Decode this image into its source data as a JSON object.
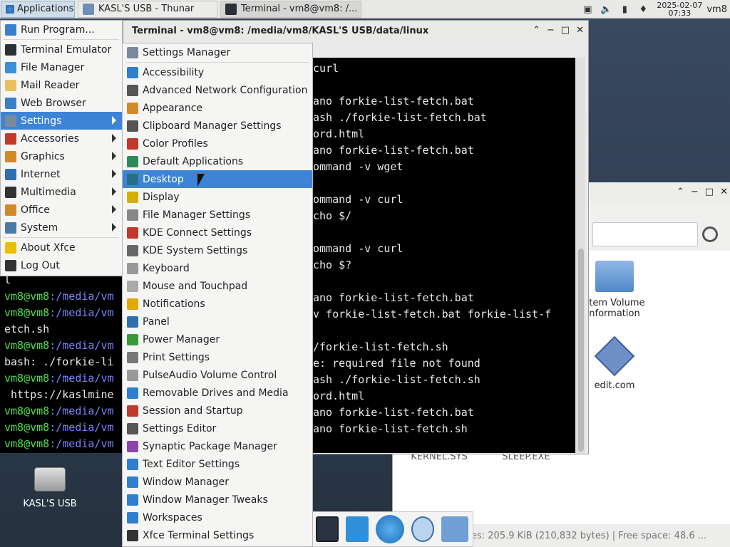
{
  "panel": {
    "applications_label": "Applications",
    "tasks": [
      {
        "label": "KASL'S USB - Thunar"
      },
      {
        "label": "Terminal - vm8@vm8: /..."
      }
    ],
    "clock_date": "2025-02-07",
    "clock_time": "07:33",
    "user": "vm8"
  },
  "terminal": {
    "title": "Terminal - vm8@vm8: /media/vm8/KASL'S USB/data/linux",
    "lines": [
      "curl",
      "",
      "ano forkie-list-fetch.bat",
      "ash ./forkie-list-fetch.bat",
      "ord.html",
      "ano forkie-list-fetch.bat",
      "ommand -v wget",
      "",
      "ommand -v curl",
      "cho $/",
      "",
      "ommand -v curl",
      "cho $?",
      "",
      "ano forkie-list-fetch.bat",
      "v forkie-list-fetch.bat forkie-list-f",
      "",
      "/forkie-list-fetch.sh",
      "e: required file not found",
      "ash ./forkie-list-fetch.sh",
      "ord.html",
      "ano forkie-list-fetch.bat",
      "ano forkie-list-fetch.sh"
    ]
  },
  "terminal2": {
    "lines": [
      {
        "prompt": "",
        "path": "",
        "text": "l"
      },
      {
        "prompt": "vm8@vm8",
        "path": ":/media/vm",
        "text": ""
      },
      {
        "prompt": "vm8@vm8",
        "path": ":/media/vm",
        "text": ""
      },
      {
        "prompt": "",
        "path": "",
        "text": "etch.sh"
      },
      {
        "prompt": "vm8@vm8",
        "path": ":/media/vm",
        "text": ""
      },
      {
        "prompt": "",
        "path": "",
        "text": "bash: ./forkie-li"
      },
      {
        "prompt": "vm8@vm8",
        "path": ":/media/vm",
        "text": ""
      },
      {
        "prompt": "",
        "path": "",
        "text": " https://kaslmine"
      },
      {
        "prompt": "vm8@vm8",
        "path": ":/media/vm",
        "text": ""
      },
      {
        "prompt": "vm8@vm8",
        "path": ":/media/vm",
        "text": ""
      },
      {
        "prompt": "vm8@vm8",
        "path": ":/media/vm",
        "text": ""
      }
    ]
  },
  "thunar": {
    "file1": "stem Volume\nnformation",
    "file2": "edit.com",
    "file3": "KERNEL.SYS",
    "file4": "SLEEP.EXE",
    "status": "es: 205.9 KiB (210,832 bytes)  |  Free space: 48.6 ..."
  },
  "desktop": {
    "icon_label": "KASL'S USB"
  },
  "app_menu": {
    "items": [
      {
        "label": "Run Program...",
        "icon": "run-icon",
        "arrow": false
      },
      {
        "sep": true
      },
      {
        "label": "Terminal Emulator",
        "icon": "terminal-icon",
        "arrow": false
      },
      {
        "label": "File Manager",
        "icon": "file-manager-icon",
        "arrow": false
      },
      {
        "label": "Mail Reader",
        "icon": "mail-icon",
        "arrow": false
      },
      {
        "label": "Web Browser",
        "icon": "web-browser-icon",
        "arrow": false
      },
      {
        "label": "Settings",
        "icon": "settings-icon",
        "arrow": true,
        "selected": true
      },
      {
        "label": "Accessories",
        "icon": "accessories-icon",
        "arrow": true
      },
      {
        "label": "Graphics",
        "icon": "graphics-icon",
        "arrow": true
      },
      {
        "label": "Internet",
        "icon": "internet-icon",
        "arrow": true
      },
      {
        "label": "Multimedia",
        "icon": "multimedia-icon",
        "arrow": true
      },
      {
        "label": "Office",
        "icon": "office-icon",
        "arrow": true
      },
      {
        "label": "System",
        "icon": "system-icon",
        "arrow": true
      },
      {
        "sep": true
      },
      {
        "label": "About Xfce",
        "icon": "star-icon",
        "arrow": false
      },
      {
        "label": "Log Out",
        "icon": "logout-icon",
        "arrow": false
      }
    ]
  },
  "settings_menu": {
    "items": [
      {
        "label": "Settings Manager",
        "color": "#7a8a9a"
      },
      {
        "sep": true
      },
      {
        "label": "Accessibility",
        "color": "#2f7fd0"
      },
      {
        "label": "Advanced Network Configuration",
        "color": "#555555"
      },
      {
        "label": "Appearance",
        "color": "#d08a2a"
      },
      {
        "label": "Clipboard Manager Settings",
        "color": "#555555"
      },
      {
        "label": "Color Profiles",
        "color": "#c0392b"
      },
      {
        "label": "Default Applications",
        "color": "#2e8b57"
      },
      {
        "label": "Desktop",
        "color": "#2a6f8a",
        "selected": true
      },
      {
        "label": "Display",
        "color": "#d4b000"
      },
      {
        "label": "File Manager Settings",
        "color": "#888888"
      },
      {
        "label": "KDE Connect Settings",
        "color": "#c0392b"
      },
      {
        "label": "KDE System Settings",
        "color": "#666666"
      },
      {
        "label": "Keyboard",
        "color": "#999999"
      },
      {
        "label": "Mouse and Touchpad",
        "color": "#aaaaaa"
      },
      {
        "label": "Notifications",
        "color": "#e0a800"
      },
      {
        "label": "Panel",
        "color": "#2f6fb0"
      },
      {
        "label": "Power Manager",
        "color": "#3a9a3a"
      },
      {
        "label": "Print Settings",
        "color": "#777777"
      },
      {
        "label": "PulseAudio Volume Control",
        "color": "#999999"
      },
      {
        "label": "Removable Drives and Media",
        "color": "#2f7fd0"
      },
      {
        "label": "Session and Startup",
        "color": "#c0392b"
      },
      {
        "label": "Settings Editor",
        "color": "#555555"
      },
      {
        "label": "Synaptic Package Manager",
        "color": "#8e44ad"
      },
      {
        "label": "Text Editor Settings",
        "color": "#2f7fd0"
      },
      {
        "label": "Window Manager",
        "color": "#2f7fd0"
      },
      {
        "label": "Window Manager Tweaks",
        "color": "#2f7fd0"
      },
      {
        "label": "Workspaces",
        "color": "#2f7fd0"
      },
      {
        "label": "Xfce Terminal Settings",
        "color": "#333333"
      }
    ]
  }
}
